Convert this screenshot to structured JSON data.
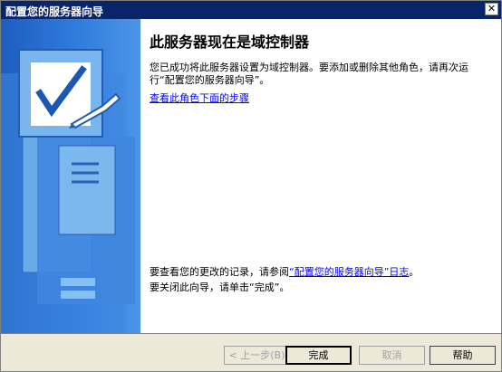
{
  "window": {
    "title": "配置您的服务器向导",
    "close_glyph": "✕"
  },
  "content": {
    "heading": "此服务器现在是域控制器",
    "description": "您已成功将此服务器设置为域控制器。要添加或删除其他角色，请再次运行“配置您的服务器向导”。",
    "steps_link": "查看此角色下面的步骤",
    "log_prefix": "要查看您的更改的记录，请参阅",
    "log_link": "“配置您的服务器向导”日志",
    "log_suffix": "。",
    "close_instruction": "要关闭此向导，请单击“完成”。"
  },
  "buttons": {
    "back": "< 上一步(B)",
    "finish": "完成",
    "cancel": "取消",
    "help": "帮助"
  },
  "icons": {
    "wizard_illustration": "server-checkmark-icon"
  }
}
